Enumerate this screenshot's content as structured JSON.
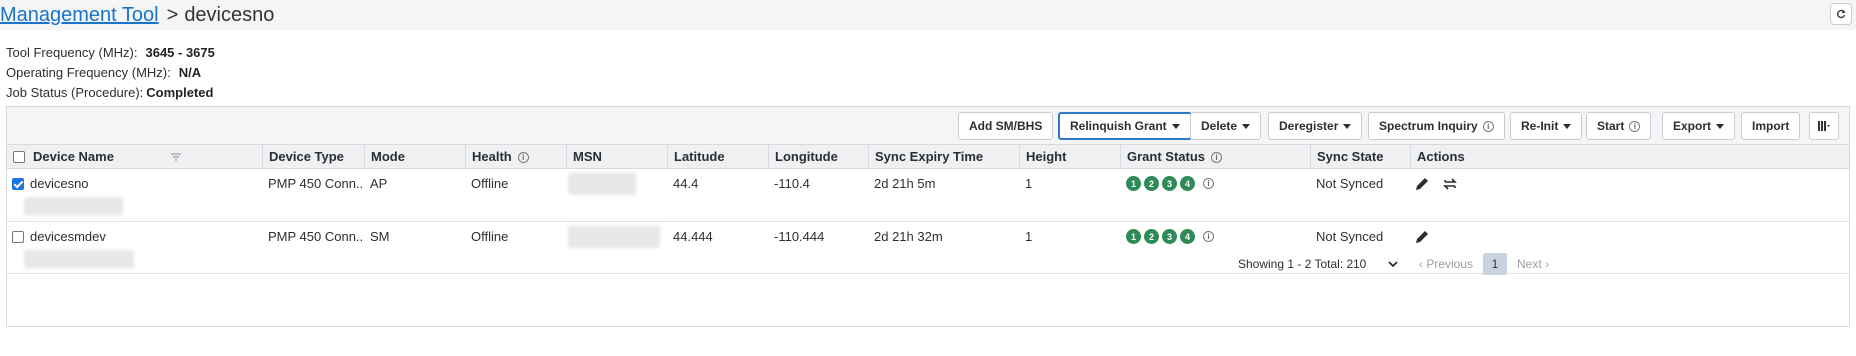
{
  "breadcrumb": {
    "root": "Management Tool",
    "separator": ">",
    "current": "devicesno"
  },
  "info": [
    {
      "label": "Tool Frequency (MHz):",
      "value": "3645 - 3675"
    },
    {
      "label": "Operating Frequency (MHz):",
      "value": "N/A"
    },
    {
      "label": "Job Status  (Procedure):",
      "value": "Completed"
    }
  ],
  "toolbar": {
    "add": "Add SM/BHS",
    "relinquish": "Relinquish Grant",
    "delete": "Delete",
    "deregister": "Deregister",
    "spectrum": "Spectrum Inquiry",
    "reinit": "Re-Init",
    "start": "Start",
    "export": "Export",
    "import": "Import"
  },
  "columns": [
    "Device Name",
    "Device Type",
    "Mode",
    "Health",
    "MSN",
    "Latitude",
    "Longitude",
    "Sync Expiry Time",
    "Height",
    "Grant Status",
    "Sync State",
    "Actions"
  ],
  "rows": [
    {
      "checked": true,
      "name": "devicesno",
      "type": "PMP 450 Conn...",
      "mode": "AP",
      "health": "Offline",
      "lat": "44.4",
      "lon": "-110.4",
      "expiry": "2d 21h 5m",
      "height": "1",
      "grants": [
        "1",
        "2",
        "3",
        "4"
      ],
      "sync": "Not Synced"
    },
    {
      "checked": false,
      "name": "devicesmdev",
      "type": "PMP 450 Conn...",
      "mode": "SM",
      "health": "Offline",
      "lat": "44.444",
      "lon": "-110.444",
      "expiry": "2d 21h 32m",
      "height": "1",
      "grants": [
        "1",
        "2",
        "3",
        "4"
      ],
      "sync": "Not Synced"
    }
  ],
  "pager": {
    "showing": "Showing 1 - 2 Total: 2",
    "page_size": "10",
    "previous": "Previous",
    "page": "1",
    "next": "Next"
  },
  "colors": {
    "link": "#1a73c9",
    "grant_badge": "#2e8b57",
    "checkbox": "#1a73e8"
  },
  "icons": [
    "refresh-icon",
    "filter-icon",
    "info-icon",
    "edit-icon",
    "swap-icon",
    "columns-icon",
    "chevron-down-icon"
  ]
}
